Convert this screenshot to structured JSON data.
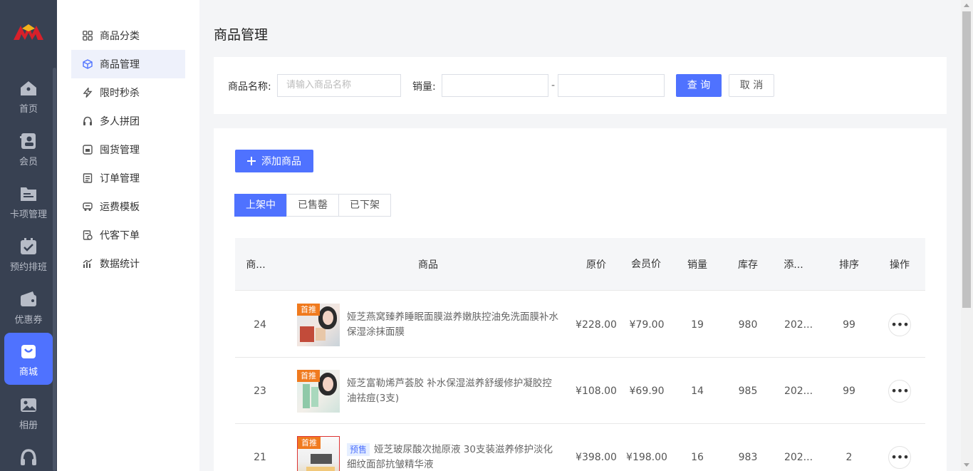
{
  "rail": {
    "items": [
      {
        "label": "首页",
        "icon": "home-icon"
      },
      {
        "label": "会员",
        "icon": "member-card-icon"
      },
      {
        "label": "卡项管理",
        "icon": "folder-icon"
      },
      {
        "label": "预约排班",
        "icon": "calendar-check-icon"
      },
      {
        "label": "优惠券",
        "icon": "wallet-icon"
      },
      {
        "label": "商城",
        "icon": "shopping-bag-icon",
        "active": true
      },
      {
        "label": "相册",
        "icon": "album-icon"
      }
    ]
  },
  "subnav": {
    "items": [
      {
        "label": "商品分类",
        "icon": "grid-icon"
      },
      {
        "label": "商品管理",
        "icon": "cube-icon",
        "active": true
      },
      {
        "label": "限时秒杀",
        "icon": "lightning-icon"
      },
      {
        "label": "多人拼团",
        "icon": "headset-icon"
      },
      {
        "label": "囤货管理",
        "icon": "store-icon"
      },
      {
        "label": "订单管理",
        "icon": "document-icon"
      },
      {
        "label": "运费模板",
        "icon": "truck-icon"
      },
      {
        "label": "代客下单",
        "icon": "order-add-icon"
      },
      {
        "label": "数据统计",
        "icon": "bar-stats-icon"
      }
    ]
  },
  "page": {
    "title": "商品管理"
  },
  "filter": {
    "name_label": "商品名称:",
    "name_placeholder": "请输入商品名称",
    "sales_label": "销量:",
    "range_sep": "-",
    "query_label": "查 询",
    "cancel_label": "取 消"
  },
  "list": {
    "add_label": "添加商品",
    "tabs": [
      "上架中",
      "已售罄",
      "已下架"
    ],
    "columns": [
      "商...",
      "商品",
      "原价",
      "会员价",
      "销量",
      "库存",
      "添...",
      "排序",
      "操作"
    ],
    "rows": [
      {
        "id": "24",
        "tag": "首推",
        "presale": "",
        "name": "娅芝燕窝臻养睡眠面膜滋养嫩肤控油免洗面膜补水保湿涂抹面膜",
        "price": "¥228.00",
        "member_price": "¥79.00",
        "sales": "19",
        "stock": "980",
        "added": "202...",
        "sort": "99"
      },
      {
        "id": "23",
        "tag": "首推",
        "presale": "",
        "name": "娅芝富勒烯芦荟胶 补水保湿滋养舒缓修护凝胶控油祛痘(3支)",
        "price": "¥108.00",
        "member_price": "¥69.90",
        "sales": "14",
        "stock": "985",
        "added": "202...",
        "sort": "99"
      },
      {
        "id": "21",
        "tag": "首推",
        "presale": "预售",
        "name": "娅芝玻尿酸次抛原液 30支装滋养修护淡化细纹面部抗皱精华液",
        "price": "¥398.00",
        "member_price": "¥198.00",
        "sales": "16",
        "stock": "983",
        "added": "202...",
        "sort": "2"
      }
    ]
  },
  "colors": {
    "accent": "#4f72ff",
    "rail_bg": "#384152",
    "tag": "#f07a1e"
  }
}
